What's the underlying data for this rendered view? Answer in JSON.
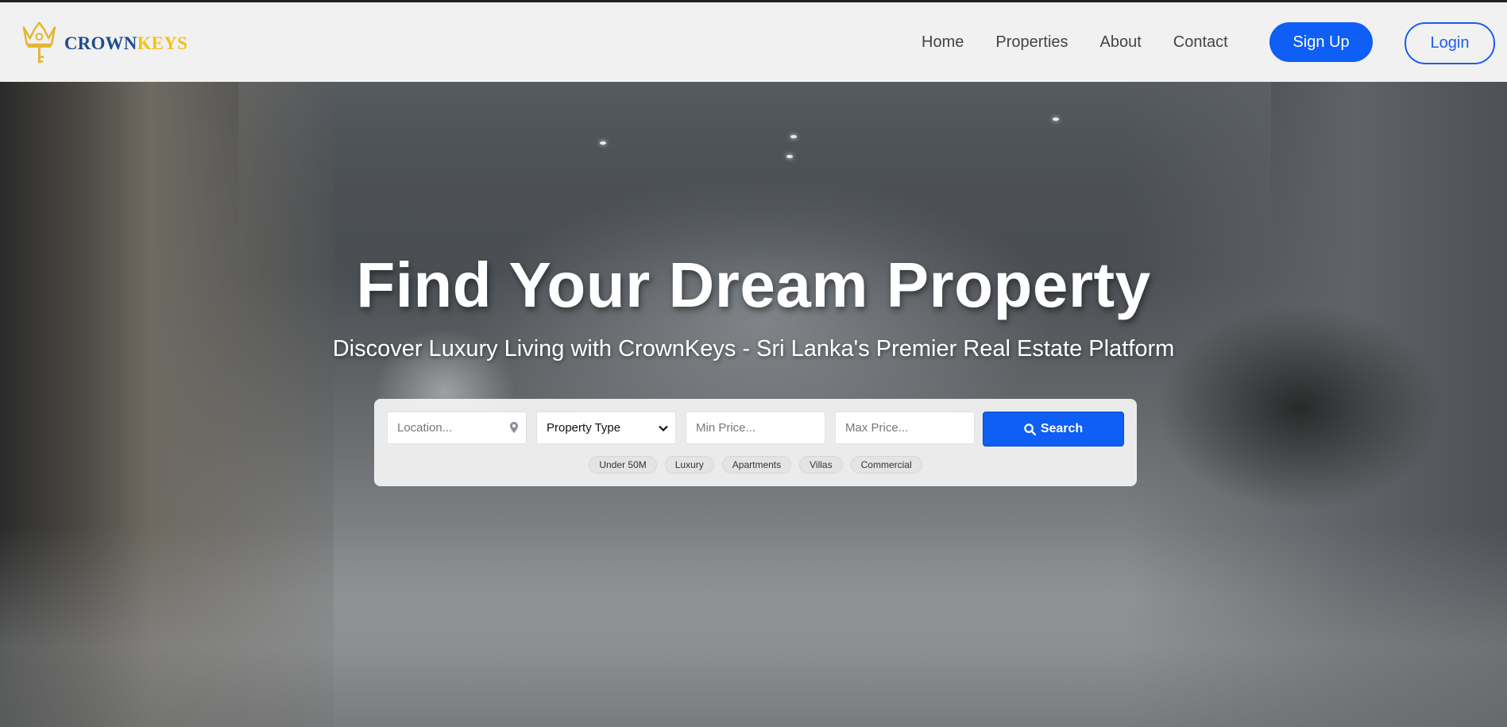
{
  "brand": {
    "part1": "CROWN",
    "part2": "KEYS",
    "crown_color": "#1f4d8c",
    "keys_color": "#f2c21a"
  },
  "nav": {
    "links": [
      "Home",
      "Properties",
      "About",
      "Contact"
    ],
    "signup_label": "Sign Up",
    "login_label": "Login",
    "accent_color": "#0f5ef5"
  },
  "hero": {
    "title": "Find Your Dream Property",
    "subtitle": "Discover Luxury Living with CrownKeys - Sri Lanka's Premier Real Estate Platform"
  },
  "search": {
    "location_placeholder": "Location...",
    "property_type_selected": "Property Type",
    "min_price_placeholder": "Min Price...",
    "max_price_placeholder": "Max Price...",
    "button_label": "Search",
    "quick_filters": [
      "Under 50M",
      "Luxury",
      "Apartments",
      "Villas",
      "Commercial"
    ]
  },
  "icons": {
    "logo": "crown-key-icon",
    "location": "map-pin-icon",
    "dropdown": "chevron-down-icon",
    "search": "search-icon"
  }
}
